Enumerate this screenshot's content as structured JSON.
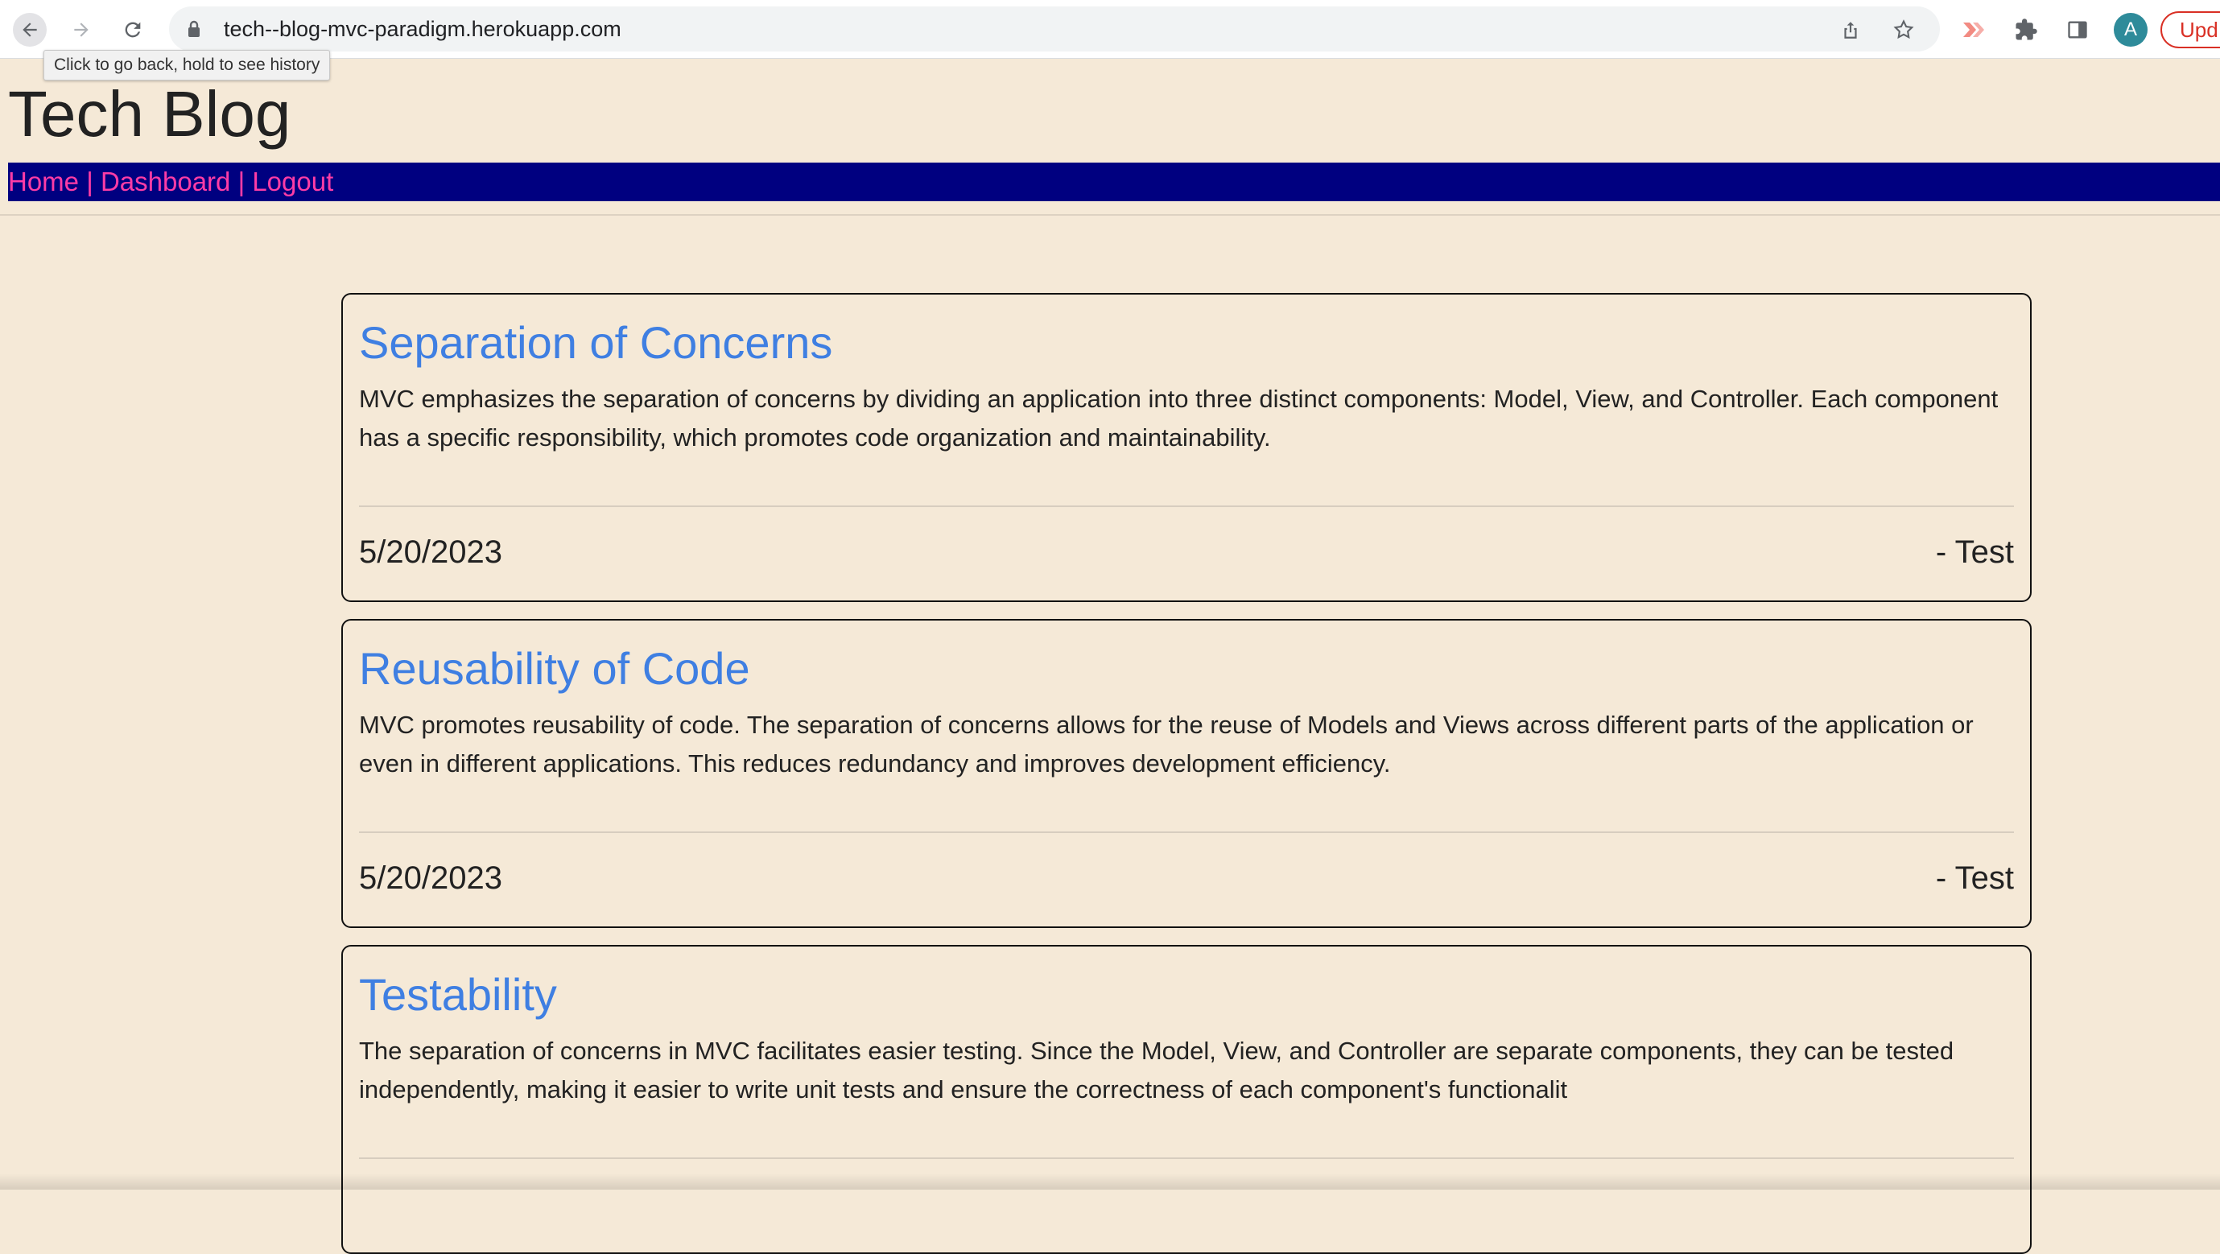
{
  "browser": {
    "url": "tech--blog-mvc-paradigm.herokuapp.com",
    "tooltip": "Click to go back, hold to see history",
    "avatar_letter": "A",
    "update_label": "Upd"
  },
  "site": {
    "title": "Tech Blog",
    "nav": {
      "home": "Home",
      "dashboard": "Dashboard",
      "logout": "Logout",
      "separator": " | "
    },
    "nav_color": "#000080",
    "link_color": "#ff3ca6",
    "title_link_color": "#3f7fe2",
    "background": "#f5e9d7"
  },
  "posts": [
    {
      "title": "Separation of Concerns",
      "body": "MVC emphasizes the separation of concerns by dividing an application into three distinct components: Model, View, and Controller. Each component has a specific responsibility, which promotes code organization and maintainability.",
      "date": "5/20/2023",
      "author": "- Test"
    },
    {
      "title": "Reusability of Code",
      "body": "MVC promotes reusability of code. The separation of concerns allows for the reuse of Models and Views across different parts of the application or even in different applications. This reduces redundancy and improves development efficiency.",
      "date": "5/20/2023",
      "author": "- Test"
    },
    {
      "title": "Testability",
      "body": "The separation of concerns in MVC facilitates easier testing. Since the Model, View, and Controller are separate components, they can be tested independently, making it easier to write unit tests and ensure the correctness of each component's functionalit",
      "date": "",
      "author": ""
    }
  ]
}
